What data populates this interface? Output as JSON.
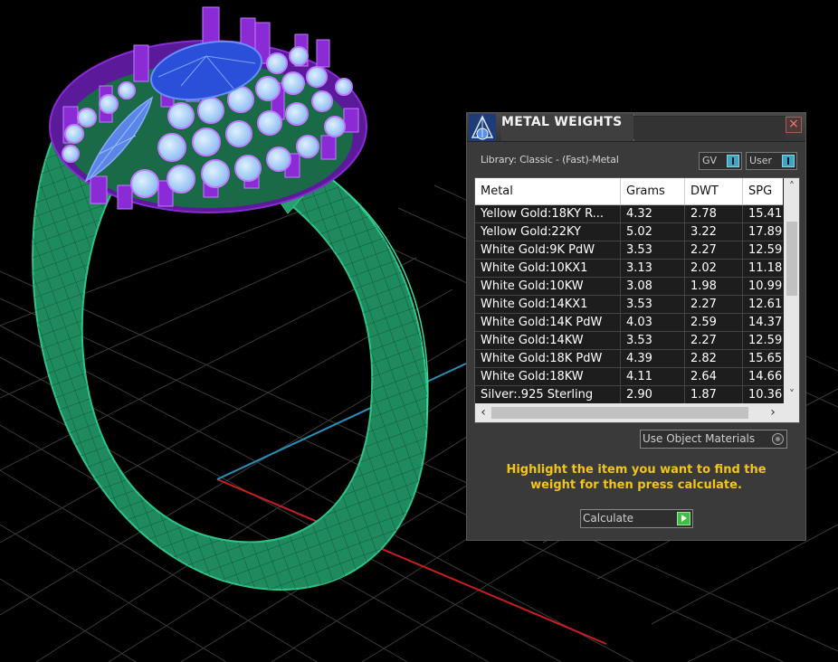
{
  "panel": {
    "title": "METAL WEIGHTS",
    "close_icon": "close-icon",
    "library_label": "Library: Classic - (Fast)-Metal",
    "toggle_gv": "GV",
    "toggle_user": "User",
    "columns": [
      "Metal",
      "Grams",
      "DWT",
      "SPG"
    ],
    "rows": [
      [
        "Yellow Gold:18KY R...",
        "4.32",
        "2.78",
        "15.41"
      ],
      [
        "Yellow Gold:22KY",
        "5.02",
        "3.22",
        "17.89"
      ],
      [
        "White Gold:9K PdW",
        "3.53",
        "2.27",
        "12.59"
      ],
      [
        "White Gold:10KX1",
        "3.13",
        "2.02",
        "11.18"
      ],
      [
        "White Gold:10KW",
        "3.08",
        "1.98",
        "10.99"
      ],
      [
        "White Gold:14KX1",
        "3.53",
        "2.27",
        "12.61"
      ],
      [
        "White Gold:14K PdW",
        "4.03",
        "2.59",
        "14.37"
      ],
      [
        "White Gold:14KW",
        "3.53",
        "2.27",
        "12.59"
      ],
      [
        "White Gold:18K PdW",
        "4.39",
        "2.82",
        "15.65"
      ],
      [
        "White Gold:18KW",
        "4.11",
        "2.64",
        "14.66"
      ],
      [
        "Silver:.925 Sterling",
        "2.90",
        "1.87",
        "10.36"
      ]
    ],
    "use_object_materials": "Use Object Materials",
    "instruction": "Highlight the item you want to find the weight for then press calculate.",
    "calculate_label": "Calculate"
  },
  "colors": {
    "background": "#000000",
    "ring_shank": "#1f8a5e",
    "prongs": "#8a2bd6",
    "accent_stones": "#a8d0f5",
    "center_stone": "#2a4fd8",
    "axis_x": "#c81e1e",
    "axis_y": "#2a8fb8",
    "instruction_text": "#f2c519"
  }
}
